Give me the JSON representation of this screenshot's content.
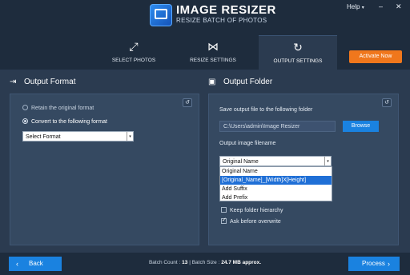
{
  "app": {
    "title": "IMAGE RESIZER",
    "subtitle": "RESIZE BATCH OF PHOTOS",
    "help_label": "Help",
    "help_caret": "▾",
    "win_minimize": "–",
    "win_close": "✕"
  },
  "tabs": [
    {
      "label": "SELECT PHOTOS",
      "icon": "resize-arrows-icon",
      "glyph": "⤢",
      "active": false
    },
    {
      "label": "RESIZE SETTINGS",
      "icon": "bowtie-icon",
      "glyph": "⋈",
      "active": false
    },
    {
      "label": "OUTPUT SETTINGS",
      "icon": "refresh-cycle-icon",
      "glyph": "↻",
      "active": true
    }
  ],
  "activate_label": "Activate Now",
  "output_format": {
    "title": "Output Format",
    "icon_glyph": "⇥",
    "refresh_glyph": "↺",
    "retain_label": "Retain the original format",
    "convert_label": "Convert to the following format",
    "selected_option": "convert",
    "format_select_value": "Select Format",
    "select_arrow": "▾"
  },
  "output_folder": {
    "title": "Output Folder",
    "icon_glyph": "▣",
    "refresh_glyph": "↺",
    "save_label": "Save output file to the following folder",
    "path_value": "C:\\Users\\admin\\Image Resizer",
    "browse_label": "Browse",
    "filename_label": "Output image filename",
    "filename_select_value": "Original Name",
    "select_arrow": "▾",
    "filename_options": [
      "Original Name",
      "[Original_Name]_[Width]X[Height]",
      "Add Suffix",
      "Add Prefix"
    ],
    "highlighted_option": "[Original_Name]_[Width]X[Height]",
    "keep_hierarchy_label": "Keep folder hierarchy",
    "keep_hierarchy_checked": false,
    "ask_overwrite_label": "Ask before overwrite",
    "ask_overwrite_checked": true
  },
  "footer": {
    "back_label": "Back",
    "back_arrow": "‹",
    "process_label": "Process",
    "process_arrow": "›",
    "batch_count_label": "Batch Count :",
    "batch_count": "13",
    "separator": "|",
    "batch_size_label": "Batch Size :",
    "batch_size": "24.7 MB approx."
  },
  "colors": {
    "background": "#2b3b50",
    "header": "#1e2c3d",
    "panel": "#354961",
    "accent_blue": "#1a82e0",
    "accent_orange": "#f0771c"
  }
}
